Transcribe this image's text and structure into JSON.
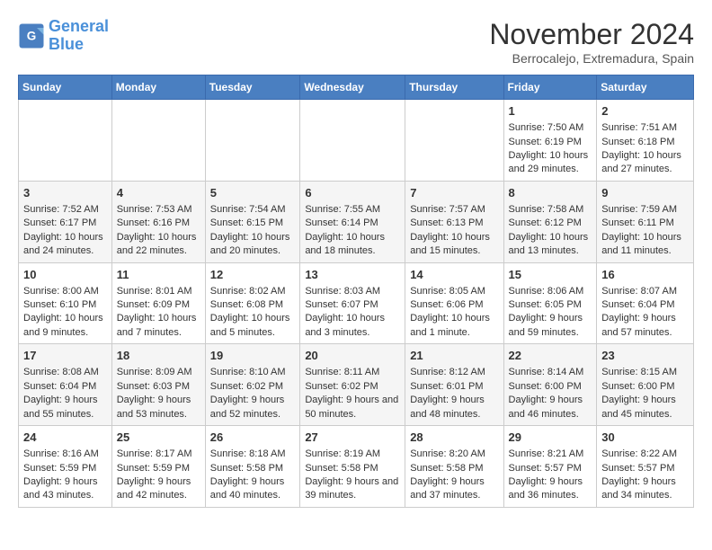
{
  "logo": {
    "line1": "General",
    "line2": "Blue"
  },
  "title": "November 2024",
  "location": "Berrocalejo, Extremadura, Spain",
  "days_of_week": [
    "Sunday",
    "Monday",
    "Tuesday",
    "Wednesday",
    "Thursday",
    "Friday",
    "Saturday"
  ],
  "weeks": [
    [
      {
        "day": "",
        "content": ""
      },
      {
        "day": "",
        "content": ""
      },
      {
        "day": "",
        "content": ""
      },
      {
        "day": "",
        "content": ""
      },
      {
        "day": "",
        "content": ""
      },
      {
        "day": "1",
        "content": "Sunrise: 7:50 AM\nSunset: 6:19 PM\nDaylight: 10 hours and 29 minutes."
      },
      {
        "day": "2",
        "content": "Sunrise: 7:51 AM\nSunset: 6:18 PM\nDaylight: 10 hours and 27 minutes."
      }
    ],
    [
      {
        "day": "3",
        "content": "Sunrise: 7:52 AM\nSunset: 6:17 PM\nDaylight: 10 hours and 24 minutes."
      },
      {
        "day": "4",
        "content": "Sunrise: 7:53 AM\nSunset: 6:16 PM\nDaylight: 10 hours and 22 minutes."
      },
      {
        "day": "5",
        "content": "Sunrise: 7:54 AM\nSunset: 6:15 PM\nDaylight: 10 hours and 20 minutes."
      },
      {
        "day": "6",
        "content": "Sunrise: 7:55 AM\nSunset: 6:14 PM\nDaylight: 10 hours and 18 minutes."
      },
      {
        "day": "7",
        "content": "Sunrise: 7:57 AM\nSunset: 6:13 PM\nDaylight: 10 hours and 15 minutes."
      },
      {
        "day": "8",
        "content": "Sunrise: 7:58 AM\nSunset: 6:12 PM\nDaylight: 10 hours and 13 minutes."
      },
      {
        "day": "9",
        "content": "Sunrise: 7:59 AM\nSunset: 6:11 PM\nDaylight: 10 hours and 11 minutes."
      }
    ],
    [
      {
        "day": "10",
        "content": "Sunrise: 8:00 AM\nSunset: 6:10 PM\nDaylight: 10 hours and 9 minutes."
      },
      {
        "day": "11",
        "content": "Sunrise: 8:01 AM\nSunset: 6:09 PM\nDaylight: 10 hours and 7 minutes."
      },
      {
        "day": "12",
        "content": "Sunrise: 8:02 AM\nSunset: 6:08 PM\nDaylight: 10 hours and 5 minutes."
      },
      {
        "day": "13",
        "content": "Sunrise: 8:03 AM\nSunset: 6:07 PM\nDaylight: 10 hours and 3 minutes."
      },
      {
        "day": "14",
        "content": "Sunrise: 8:05 AM\nSunset: 6:06 PM\nDaylight: 10 hours and 1 minute."
      },
      {
        "day": "15",
        "content": "Sunrise: 8:06 AM\nSunset: 6:05 PM\nDaylight: 9 hours and 59 minutes."
      },
      {
        "day": "16",
        "content": "Sunrise: 8:07 AM\nSunset: 6:04 PM\nDaylight: 9 hours and 57 minutes."
      }
    ],
    [
      {
        "day": "17",
        "content": "Sunrise: 8:08 AM\nSunset: 6:04 PM\nDaylight: 9 hours and 55 minutes."
      },
      {
        "day": "18",
        "content": "Sunrise: 8:09 AM\nSunset: 6:03 PM\nDaylight: 9 hours and 53 minutes."
      },
      {
        "day": "19",
        "content": "Sunrise: 8:10 AM\nSunset: 6:02 PM\nDaylight: 9 hours and 52 minutes."
      },
      {
        "day": "20",
        "content": "Sunrise: 8:11 AM\nSunset: 6:02 PM\nDaylight: 9 hours and 50 minutes."
      },
      {
        "day": "21",
        "content": "Sunrise: 8:12 AM\nSunset: 6:01 PM\nDaylight: 9 hours and 48 minutes."
      },
      {
        "day": "22",
        "content": "Sunrise: 8:14 AM\nSunset: 6:00 PM\nDaylight: 9 hours and 46 minutes."
      },
      {
        "day": "23",
        "content": "Sunrise: 8:15 AM\nSunset: 6:00 PM\nDaylight: 9 hours and 45 minutes."
      }
    ],
    [
      {
        "day": "24",
        "content": "Sunrise: 8:16 AM\nSunset: 5:59 PM\nDaylight: 9 hours and 43 minutes."
      },
      {
        "day": "25",
        "content": "Sunrise: 8:17 AM\nSunset: 5:59 PM\nDaylight: 9 hours and 42 minutes."
      },
      {
        "day": "26",
        "content": "Sunrise: 8:18 AM\nSunset: 5:58 PM\nDaylight: 9 hours and 40 minutes."
      },
      {
        "day": "27",
        "content": "Sunrise: 8:19 AM\nSunset: 5:58 PM\nDaylight: 9 hours and 39 minutes."
      },
      {
        "day": "28",
        "content": "Sunrise: 8:20 AM\nSunset: 5:58 PM\nDaylight: 9 hours and 37 minutes."
      },
      {
        "day": "29",
        "content": "Sunrise: 8:21 AM\nSunset: 5:57 PM\nDaylight: 9 hours and 36 minutes."
      },
      {
        "day": "30",
        "content": "Sunrise: 8:22 AM\nSunset: 5:57 PM\nDaylight: 9 hours and 34 minutes."
      }
    ]
  ]
}
